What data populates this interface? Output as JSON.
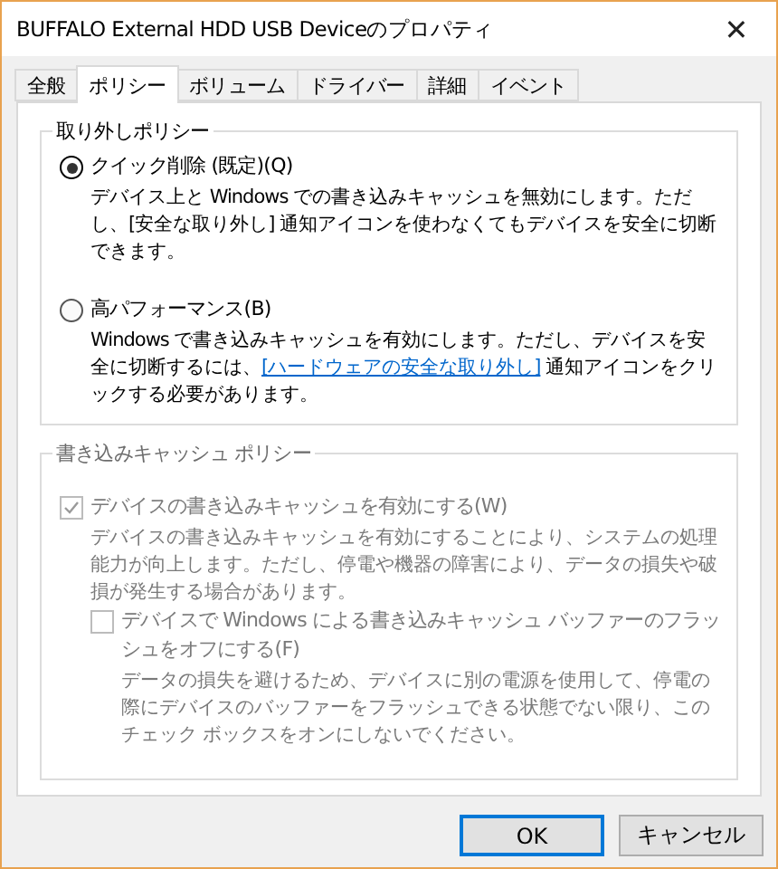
{
  "window": {
    "title": "BUFFALO External HDD USB Deviceのプロパティ",
    "close": "✕"
  },
  "tabs": [
    {
      "label": "全般",
      "selected": false
    },
    {
      "label": "ポリシー",
      "selected": true
    },
    {
      "label": "ボリューム",
      "selected": false
    },
    {
      "label": "ドライバー",
      "selected": false
    },
    {
      "label": "詳細",
      "selected": false
    },
    {
      "label": "イベント",
      "selected": false
    }
  ],
  "removal_policy": {
    "title": "取り外しポリシー",
    "options": [
      {
        "label": "クイック削除 (既定)(Q)",
        "selected": true,
        "description": {
          "before": "デバイス上と Windows での書き込みキャッシュを無効にします。ただし、[安全な取り外し] 通知アイコンを使わなくてもデバイスを安全に切断できます。"
        }
      },
      {
        "label": "高パフォーマンス(B)",
        "selected": false,
        "description": {
          "before": "Windows で書き込みキャッシュを有効にします。ただし、デバイスを安全に切断するには、",
          "link": "[ハードウェアの安全な取り外し]",
          "after": " 通知アイコンをクリックする必要があります。"
        }
      }
    ]
  },
  "write_cache_policy": {
    "title": "書き込みキャッシュ ポリシー",
    "options": [
      {
        "label": "デバイスの書き込みキャッシュを有効にする(W)",
        "checked": true,
        "disabled": true,
        "description": "デバイスの書き込みキャッシュを有効にすることにより、システムの処理能力が向上します。ただし、停電や機器の障害により、データの損失や破損が発生する場合があります。",
        "children": [
          {
            "label": "デバイスで Windows による書き込みキャッシュ バッファーのフラッシュをオフにする(F)",
            "checked": false,
            "disabled": true,
            "description": "データの損失を避けるため、デバイスに別の電源を使用して、停電の際にデバイスのバッファーをフラッシュできる状態でない限り、このチェック ボックスをオンにしないでください。"
          }
        ]
      }
    ]
  },
  "buttons": [
    {
      "label": "OK",
      "default": true
    },
    {
      "label": "キャンセル",
      "default": false
    }
  ]
}
